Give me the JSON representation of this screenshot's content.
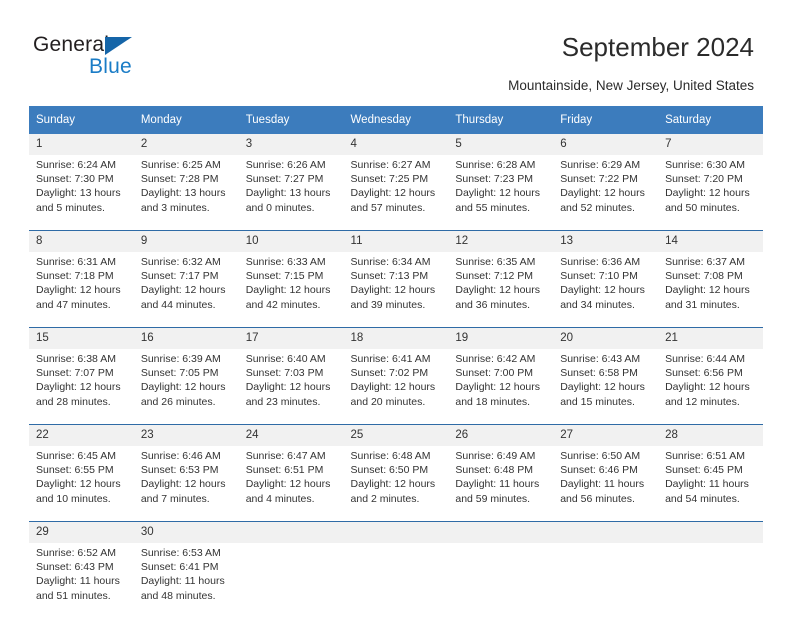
{
  "brand": {
    "name_part1": "General",
    "name_part2": "Blue",
    "accent_color": "#1a7cc6",
    "triangle_color": "#1565a8"
  },
  "header": {
    "title": "September 2024",
    "subtitle": "Mountainside, New Jersey, United States"
  },
  "calendar": {
    "header_bg": "#3c7cbd",
    "daynum_bg": "#f1f1f1",
    "separator_color": "#2f6ba6",
    "weekday_headers": [
      "Sunday",
      "Monday",
      "Tuesday",
      "Wednesday",
      "Thursday",
      "Friday",
      "Saturday"
    ],
    "weeks": [
      {
        "days": [
          {
            "day": "1",
            "sunrise": "Sunrise: 6:24 AM",
            "sunset": "Sunset: 7:30 PM",
            "daylight_line1": "Daylight: 13 hours",
            "daylight_line2": "and 5 minutes."
          },
          {
            "day": "2",
            "sunrise": "Sunrise: 6:25 AM",
            "sunset": "Sunset: 7:28 PM",
            "daylight_line1": "Daylight: 13 hours",
            "daylight_line2": "and 3 minutes."
          },
          {
            "day": "3",
            "sunrise": "Sunrise: 6:26 AM",
            "sunset": "Sunset: 7:27 PM",
            "daylight_line1": "Daylight: 13 hours",
            "daylight_line2": "and 0 minutes."
          },
          {
            "day": "4",
            "sunrise": "Sunrise: 6:27 AM",
            "sunset": "Sunset: 7:25 PM",
            "daylight_line1": "Daylight: 12 hours",
            "daylight_line2": "and 57 minutes."
          },
          {
            "day": "5",
            "sunrise": "Sunrise: 6:28 AM",
            "sunset": "Sunset: 7:23 PM",
            "daylight_line1": "Daylight: 12 hours",
            "daylight_line2": "and 55 minutes."
          },
          {
            "day": "6",
            "sunrise": "Sunrise: 6:29 AM",
            "sunset": "Sunset: 7:22 PM",
            "daylight_line1": "Daylight: 12 hours",
            "daylight_line2": "and 52 minutes."
          },
          {
            "day": "7",
            "sunrise": "Sunrise: 6:30 AM",
            "sunset": "Sunset: 7:20 PM",
            "daylight_line1": "Daylight: 12 hours",
            "daylight_line2": "and 50 minutes."
          }
        ]
      },
      {
        "days": [
          {
            "day": "8",
            "sunrise": "Sunrise: 6:31 AM",
            "sunset": "Sunset: 7:18 PM",
            "daylight_line1": "Daylight: 12 hours",
            "daylight_line2": "and 47 minutes."
          },
          {
            "day": "9",
            "sunrise": "Sunrise: 6:32 AM",
            "sunset": "Sunset: 7:17 PM",
            "daylight_line1": "Daylight: 12 hours",
            "daylight_line2": "and 44 minutes."
          },
          {
            "day": "10",
            "sunrise": "Sunrise: 6:33 AM",
            "sunset": "Sunset: 7:15 PM",
            "daylight_line1": "Daylight: 12 hours",
            "daylight_line2": "and 42 minutes."
          },
          {
            "day": "11",
            "sunrise": "Sunrise: 6:34 AM",
            "sunset": "Sunset: 7:13 PM",
            "daylight_line1": "Daylight: 12 hours",
            "daylight_line2": "and 39 minutes."
          },
          {
            "day": "12",
            "sunrise": "Sunrise: 6:35 AM",
            "sunset": "Sunset: 7:12 PM",
            "daylight_line1": "Daylight: 12 hours",
            "daylight_line2": "and 36 minutes."
          },
          {
            "day": "13",
            "sunrise": "Sunrise: 6:36 AM",
            "sunset": "Sunset: 7:10 PM",
            "daylight_line1": "Daylight: 12 hours",
            "daylight_line2": "and 34 minutes."
          },
          {
            "day": "14",
            "sunrise": "Sunrise: 6:37 AM",
            "sunset": "Sunset: 7:08 PM",
            "daylight_line1": "Daylight: 12 hours",
            "daylight_line2": "and 31 minutes."
          }
        ]
      },
      {
        "days": [
          {
            "day": "15",
            "sunrise": "Sunrise: 6:38 AM",
            "sunset": "Sunset: 7:07 PM",
            "daylight_line1": "Daylight: 12 hours",
            "daylight_line2": "and 28 minutes."
          },
          {
            "day": "16",
            "sunrise": "Sunrise: 6:39 AM",
            "sunset": "Sunset: 7:05 PM",
            "daylight_line1": "Daylight: 12 hours",
            "daylight_line2": "and 26 minutes."
          },
          {
            "day": "17",
            "sunrise": "Sunrise: 6:40 AM",
            "sunset": "Sunset: 7:03 PM",
            "daylight_line1": "Daylight: 12 hours",
            "daylight_line2": "and 23 minutes."
          },
          {
            "day": "18",
            "sunrise": "Sunrise: 6:41 AM",
            "sunset": "Sunset: 7:02 PM",
            "daylight_line1": "Daylight: 12 hours",
            "daylight_line2": "and 20 minutes."
          },
          {
            "day": "19",
            "sunrise": "Sunrise: 6:42 AM",
            "sunset": "Sunset: 7:00 PM",
            "daylight_line1": "Daylight: 12 hours",
            "daylight_line2": "and 18 minutes."
          },
          {
            "day": "20",
            "sunrise": "Sunrise: 6:43 AM",
            "sunset": "Sunset: 6:58 PM",
            "daylight_line1": "Daylight: 12 hours",
            "daylight_line2": "and 15 minutes."
          },
          {
            "day": "21",
            "sunrise": "Sunrise: 6:44 AM",
            "sunset": "Sunset: 6:56 PM",
            "daylight_line1": "Daylight: 12 hours",
            "daylight_line2": "and 12 minutes."
          }
        ]
      },
      {
        "days": [
          {
            "day": "22",
            "sunrise": "Sunrise: 6:45 AM",
            "sunset": "Sunset: 6:55 PM",
            "daylight_line1": "Daylight: 12 hours",
            "daylight_line2": "and 10 minutes."
          },
          {
            "day": "23",
            "sunrise": "Sunrise: 6:46 AM",
            "sunset": "Sunset: 6:53 PM",
            "daylight_line1": "Daylight: 12 hours",
            "daylight_line2": "and 7 minutes."
          },
          {
            "day": "24",
            "sunrise": "Sunrise: 6:47 AM",
            "sunset": "Sunset: 6:51 PM",
            "daylight_line1": "Daylight: 12 hours",
            "daylight_line2": "and 4 minutes."
          },
          {
            "day": "25",
            "sunrise": "Sunrise: 6:48 AM",
            "sunset": "Sunset: 6:50 PM",
            "daylight_line1": "Daylight: 12 hours",
            "daylight_line2": "and 2 minutes."
          },
          {
            "day": "26",
            "sunrise": "Sunrise: 6:49 AM",
            "sunset": "Sunset: 6:48 PM",
            "daylight_line1": "Daylight: 11 hours",
            "daylight_line2": "and 59 minutes."
          },
          {
            "day": "27",
            "sunrise": "Sunrise: 6:50 AM",
            "sunset": "Sunset: 6:46 PM",
            "daylight_line1": "Daylight: 11 hours",
            "daylight_line2": "and 56 minutes."
          },
          {
            "day": "28",
            "sunrise": "Sunrise: 6:51 AM",
            "sunset": "Sunset: 6:45 PM",
            "daylight_line1": "Daylight: 11 hours",
            "daylight_line2": "and 54 minutes."
          }
        ]
      },
      {
        "days": [
          {
            "day": "29",
            "sunrise": "Sunrise: 6:52 AM",
            "sunset": "Sunset: 6:43 PM",
            "daylight_line1": "Daylight: 11 hours",
            "daylight_line2": "and 51 minutes."
          },
          {
            "day": "30",
            "sunrise": "Sunrise: 6:53 AM",
            "sunset": "Sunset: 6:41 PM",
            "daylight_line1": "Daylight: 11 hours",
            "daylight_line2": "and 48 minutes."
          },
          {
            "day": "",
            "sunrise": "",
            "sunset": "",
            "daylight_line1": "",
            "daylight_line2": ""
          },
          {
            "day": "",
            "sunrise": "",
            "sunset": "",
            "daylight_line1": "",
            "daylight_line2": ""
          },
          {
            "day": "",
            "sunrise": "",
            "sunset": "",
            "daylight_line1": "",
            "daylight_line2": ""
          },
          {
            "day": "",
            "sunrise": "",
            "sunset": "",
            "daylight_line1": "",
            "daylight_line2": ""
          },
          {
            "day": "",
            "sunrise": "",
            "sunset": "",
            "daylight_line1": "",
            "daylight_line2": ""
          }
        ]
      }
    ]
  }
}
